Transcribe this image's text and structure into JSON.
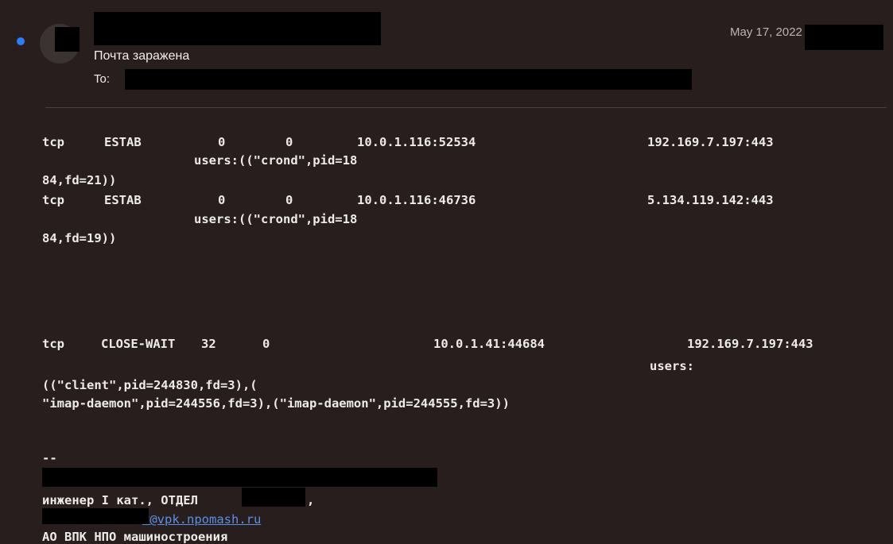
{
  "header": {
    "subject": "Почта заражена",
    "to_label": "To:",
    "date": "May 17, 2022 a"
  },
  "body": {
    "conn1": {
      "proto": "tcp",
      "state": "ESTAB",
      "recv_q": "0",
      "send_q": "0",
      "local": "10.0.1.116:52534",
      "peer": "192.169.7.197:443",
      "users": "users:((\"crond\",pid=18",
      "cont": "84,fd=21))"
    },
    "conn2": {
      "proto": "tcp",
      "state": "ESTAB",
      "recv_q": "0",
      "send_q": "0",
      "local": "10.0.1.116:46736",
      "peer": "5.134.119.142:443",
      "users": "users:((\"crond\",pid=18",
      "cont": "84,fd=19))"
    },
    "conn3": {
      "proto": "tcp",
      "state": "CLOSE-WAIT",
      "recv_q": "32",
      "send_q": "0",
      "local": "10.0.1.41:44684",
      "peer": "192.169.7.197:443",
      "users_label": "users:",
      "line2": "((\"client\",pid=244830,fd=3),(",
      "line3": "\"imap-daemon\",pid=244556,fd=3),(\"imap-daemon\",pid=244555,fd=3))"
    }
  },
  "signature": {
    "separator": "--",
    "title": "инженер I кат., ОТДЕЛ",
    "title_comma": ",",
    "email": "v@vpk.npomash.ru",
    "org": "АО ВПК НПО машиностроения"
  }
}
